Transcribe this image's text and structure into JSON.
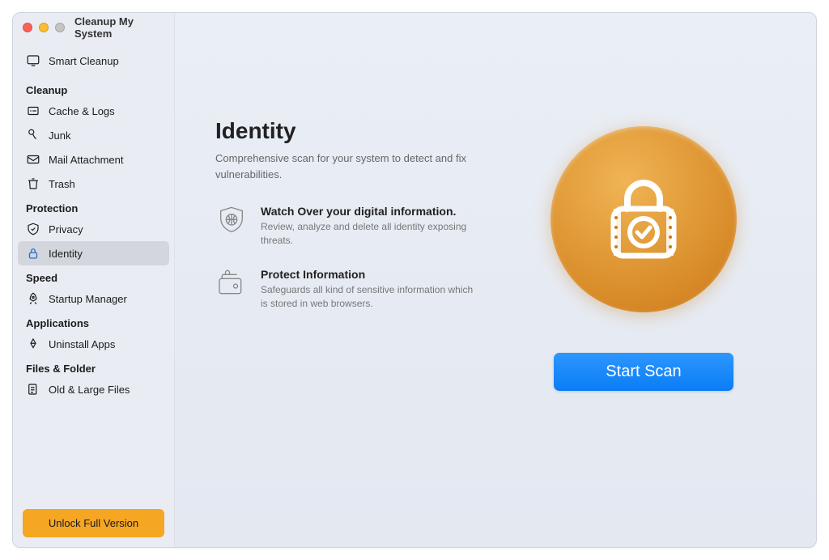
{
  "window": {
    "title": "Cleanup My System"
  },
  "sidebar": {
    "smart_cleanup": "Smart Cleanup",
    "sections": {
      "cleanup": {
        "label": "Cleanup",
        "items": [
          "Cache & Logs",
          "Junk",
          "Mail Attachment",
          "Trash"
        ]
      },
      "protection": {
        "label": "Protection",
        "items": [
          "Privacy",
          "Identity"
        ]
      },
      "speed": {
        "label": "Speed",
        "items": [
          "Startup Manager"
        ]
      },
      "applications": {
        "label": "Applications",
        "items": [
          "Uninstall Apps"
        ]
      },
      "files": {
        "label": "Files & Folder",
        "items": [
          "Old & Large Files"
        ]
      }
    },
    "unlock_button": "Unlock Full Version"
  },
  "main": {
    "title": "Identity",
    "subtitle": "Comprehensive scan for your system to detect and fix vulnerabilities.",
    "features": [
      {
        "title": "Watch Over your digital information.",
        "desc": "Review, analyze and delete all identity exposing threats."
      },
      {
        "title": "Protect Information",
        "desc": "Safeguards all kind of sensitive information which is stored in web browsers."
      }
    ],
    "scan_button": "Start Scan"
  },
  "colors": {
    "accent": "#f5a623",
    "primary_button": "#0a7cf5"
  }
}
